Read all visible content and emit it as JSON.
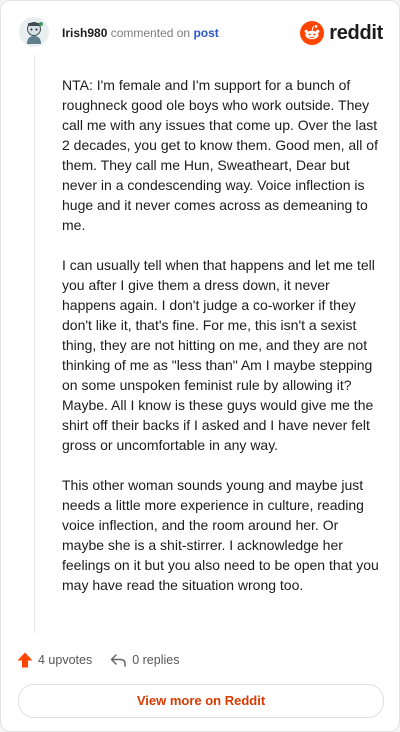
{
  "header": {
    "username": "Irish980",
    "action_text": "commented on",
    "link_text": "post",
    "brand": "reddit"
  },
  "comment": {
    "paragraphs": [
      "NTA: I'm female and I'm support for a bunch of roughneck good ole boys who work outside. They call me with any issues that come up. Over the last 2 decades, you get to know them. Good men, all of them. They call me Hun, Sweatheart, Dear but never in a condescending way. Voice inflection is huge and it never comes across as demeaning to me.",
      "I can usually tell when that happens and let me tell you after I give them a dress down, it never happens again. I don't judge a co-worker if they don't like it, that's fine. For me, this isn't a sexist thing, they are not hitting on me, and they are not thinking of me as \"less than\" Am I maybe stepping on some unspoken feminist rule by allowing it? Maybe. All I know is these guys would give me the shirt off their backs if I asked and I have never felt gross or uncomfortable in any way.",
      "This other woman sounds young and maybe just needs a little more experience in culture, reading voice inflection, and the room around her. Or maybe she is a shit-stirrer. I acknowledge her feelings on it but you also need to be open that you may have read the situation wrong too."
    ]
  },
  "footer": {
    "upvotes": "4 upvotes",
    "replies": "0 replies",
    "view_more": "View more on Reddit"
  },
  "colors": {
    "reddit_orange": "#ff4500",
    "link_blue": "#2a56c6",
    "button_text": "#d93a00"
  },
  "icons": [
    "avatar-icon",
    "reddit-logo-icon",
    "upvote-arrow-icon",
    "reply-icon"
  ]
}
